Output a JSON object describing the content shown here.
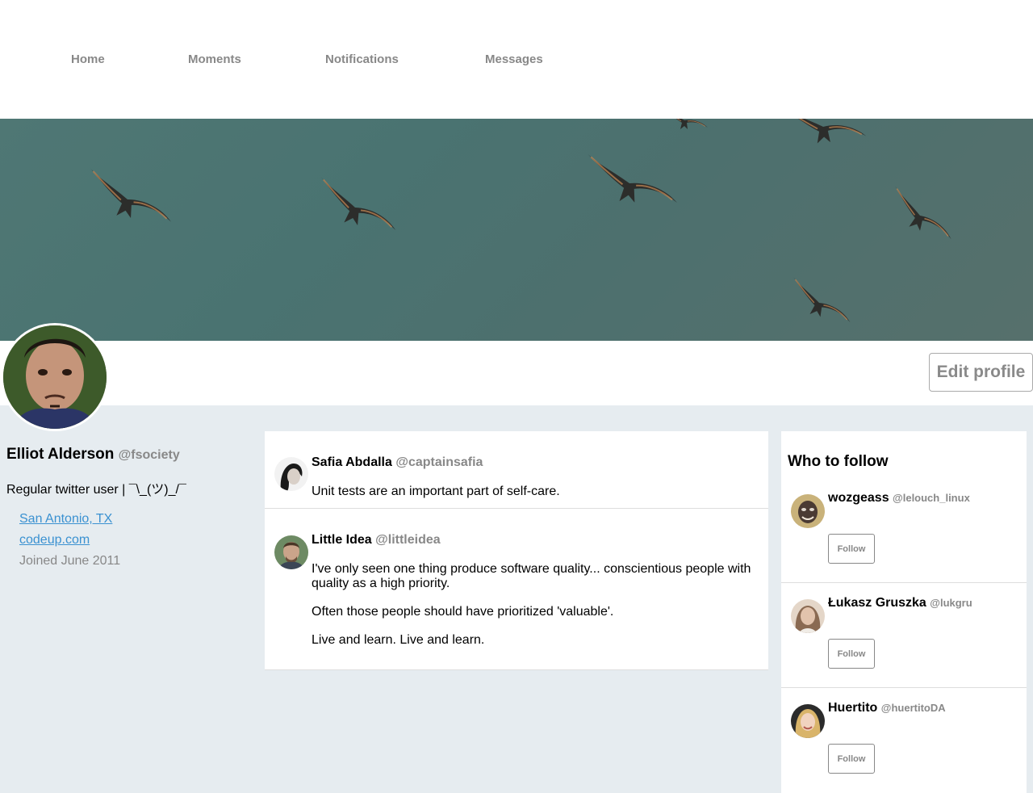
{
  "nav": {
    "items": [
      {
        "label": "Home"
      },
      {
        "label": "Moments"
      },
      {
        "label": "Notifications"
      },
      {
        "label": "Messages"
      }
    ]
  },
  "profile": {
    "name": "Elliot Alderson",
    "handle": "@fsociety",
    "bio": "Regular twitter user | ¯\\_(ツ)_/¯",
    "location": "San Antonio, TX",
    "website": "codeup.com",
    "joined": "Joined June 2011",
    "edit_label": "Edit profile"
  },
  "tweets": [
    {
      "name": "Safia Abdalla",
      "handle": "@captainsafia",
      "paragraphs": [
        "Unit tests are an important part of self-care."
      ]
    },
    {
      "name": "Little Idea",
      "handle": "@littleidea",
      "paragraphs": [
        "I've only seen one thing produce software quality... conscientious people with quality as a high priority.",
        "Often those people should have prioritized 'valuable'.",
        "Live and learn. Live and learn."
      ]
    }
  ],
  "who_to_follow": {
    "title": "Who to follow",
    "follow_label": "Follow",
    "users": [
      {
        "name": "wozgeass",
        "handle": "@lelouch_linux"
      },
      {
        "name": "Łukasz Gruszka",
        "handle": "@lukgru"
      },
      {
        "name": "Huertito",
        "handle": "@huertitoDA"
      }
    ]
  },
  "colors": {
    "background": "#e6ecf0",
    "link": "#3a91d1",
    "muted": "#888888",
    "banner": "#4f7774"
  }
}
